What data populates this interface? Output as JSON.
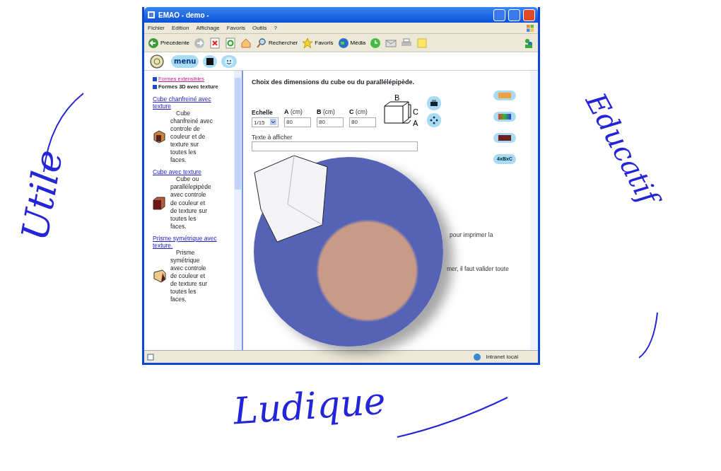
{
  "decor_words": [
    {
      "text": "Utile",
      "kind": "left"
    },
    {
      "text": "Educatif",
      "kind": "right"
    },
    {
      "text": "Ludique",
      "kind": "bottom"
    }
  ],
  "window": {
    "title": "EMAO - demo -"
  },
  "menu": [
    "Fichier",
    "Edition",
    "Affichage",
    "Favoris",
    "Outils",
    "?"
  ],
  "toolbar": [
    {
      "label": "Précédente",
      "kind": "back"
    },
    {
      "kind": "forward"
    },
    {
      "kind": "stop"
    },
    {
      "kind": "refresh"
    },
    {
      "kind": "home"
    },
    {
      "label": "Rechercher",
      "kind": "search"
    },
    {
      "label": "Favoris",
      "kind": "star"
    },
    {
      "label": "Média",
      "kind": "media"
    },
    {
      "kind": "history"
    },
    {
      "kind": "mail"
    },
    {
      "kind": "print"
    },
    {
      "kind": "note"
    }
  ],
  "app_toolbar": {
    "menu_label": "menu"
  },
  "sidebar": {
    "sections": [
      {
        "label": "Formes extensibles",
        "kind": "link"
      },
      {
        "label": "Formes 3D avec texture",
        "kind": "bold"
      }
    ],
    "items": [
      {
        "title": "Cube chanfreiné avec texture",
        "description": "Cube chanfreiné avec controle de couleur et de texture sur toutes les faces.",
        "kind": "bevel"
      },
      {
        "title": "Cube avec texture",
        "description": "Cube ou parallélepipède avec controle de couleur et de texture sur toutes les faces.",
        "kind": "cube"
      },
      {
        "title": "Prisme symétrique avec texture.",
        "description": "Prisme symétrique avec controle de couleur et de texture sur toutes les faces.",
        "kind": "prism"
      }
    ]
  },
  "main": {
    "heading": "Choix des dimensions du cube ou du parallélépipède.",
    "scale": {
      "label": "Echelle",
      "value": "1/15"
    },
    "dims": [
      {
        "letter": "A",
        "unit": "(cm)",
        "value": "80"
      },
      {
        "letter": "B",
        "unit": "(cm)",
        "value": "80"
      },
      {
        "letter": "C",
        "unit": "(cm)",
        "value": "80"
      }
    ],
    "diagram_labels": [
      "B",
      "C",
      "A"
    ],
    "text_field": {
      "label": "Texte à afficher"
    },
    "side_buttons": [
      {
        "kind": "orange"
      },
      {
        "kind": "colors"
      },
      {
        "kind": "texture"
      },
      {
        "kind": "formula",
        "label": "4xBxC"
      }
    ],
    "hidden_lines": [
      "pour imprimer la",
      "mer, il faut valider toute"
    ]
  },
  "status_bar": {
    "zone": "Intranet local"
  }
}
